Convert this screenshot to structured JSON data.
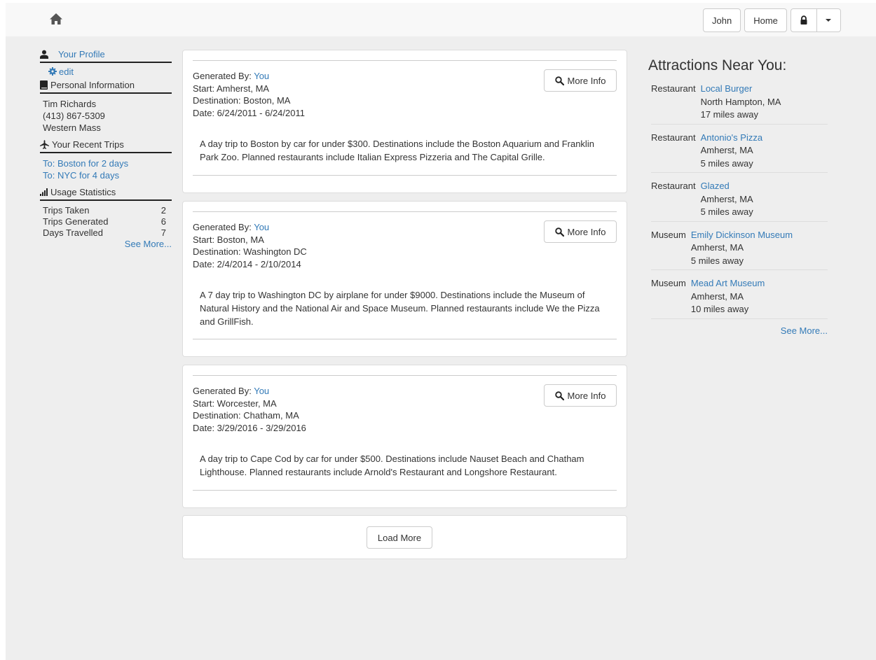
{
  "navbar": {
    "home_icon": "home-icon",
    "user_label": "John",
    "home_label": "Home",
    "lock_icon": "lock-icon",
    "caret_icon": "caret-down-icon"
  },
  "sidebar": {
    "profile": {
      "label": "Your Profile",
      "icon": "user-icon"
    },
    "edit": {
      "label": "edit",
      "icon": "gear-icon"
    },
    "personal": {
      "label": "Personal Information",
      "icon": "book-icon",
      "lines": [
        "Tim Richards",
        "(413) 867-5309",
        "Western Mass"
      ]
    },
    "recent": {
      "label": "Your Recent Trips",
      "icon": "plane-icon",
      "trips": [
        "To: Boston for 2 days",
        "To: NYC for 4 days"
      ]
    },
    "usage": {
      "label": "Usage Statistics",
      "icon": "signal-icon",
      "stats": [
        {
          "label": "Trips Taken",
          "value": "2"
        },
        {
          "label": "Trips Generated",
          "value": "6"
        },
        {
          "label": "Days Travelled",
          "value": "7"
        }
      ],
      "see_more": "See More..."
    }
  },
  "trips": [
    {
      "generated_label": "Generated By: ",
      "generated_by": "You",
      "start": "Start: Amherst, MA",
      "destination": "Destination: Boston, MA",
      "date": "Date: 6/24/2011 - 6/24/2011",
      "more_info": "More Info",
      "description": "A day trip to Boston by car for under $300. Destinations include the Boston Aquarium and Franklin Park Zoo. Planned restaurants include Italian Express Pizzeria and The Capital Grille."
    },
    {
      "generated_label": "Generated By: ",
      "generated_by": "You",
      "start": "Start: Boston, MA",
      "destination": "Destination: Washington DC",
      "date": "Date: 2/4/2014 - 2/10/2014",
      "more_info": "More Info",
      "description": "A 7 day trip to Washington DC by airplane for under $9000. Destinations include the Museum of Natural History and the National Air and Space Museum. Planned restaurants include We the Pizza and GrillFish."
    },
    {
      "generated_label": "Generated By: ",
      "generated_by": "You",
      "start": "Start: Worcester, MA",
      "destination": "Destination: Chatham, MA",
      "date": "Date: 3/29/2016 - 3/29/2016",
      "more_info": "More Info",
      "description": "A day trip to Cape Cod by car for under $500. Destinations include Nauset Beach and Chatham Lighthouse. Planned restaurants include Arnold's Restaurant and Longshore Restaurant."
    }
  ],
  "load_more": "Load More",
  "attractions": {
    "title": "Attractions Near You:",
    "items": [
      {
        "type": "Restaurant",
        "name": "Local Burger",
        "location": "North Hampton, MA",
        "distance": "17 miles away"
      },
      {
        "type": "Restaurant",
        "name": "Antonio's Pizza",
        "location": "Amherst, MA",
        "distance": "5 miles away"
      },
      {
        "type": "Restaurant",
        "name": "Glazed",
        "location": "Amherst, MA",
        "distance": "5 miles away"
      },
      {
        "type": "Museum",
        "name": "Emily Dickinson Museum",
        "location": "Amherst, MA",
        "distance": "5 miles away"
      },
      {
        "type": "Museum",
        "name": "Mead Art Museum",
        "location": "Amherst, MA",
        "distance": "10 miles away"
      }
    ],
    "see_more": "See More..."
  }
}
